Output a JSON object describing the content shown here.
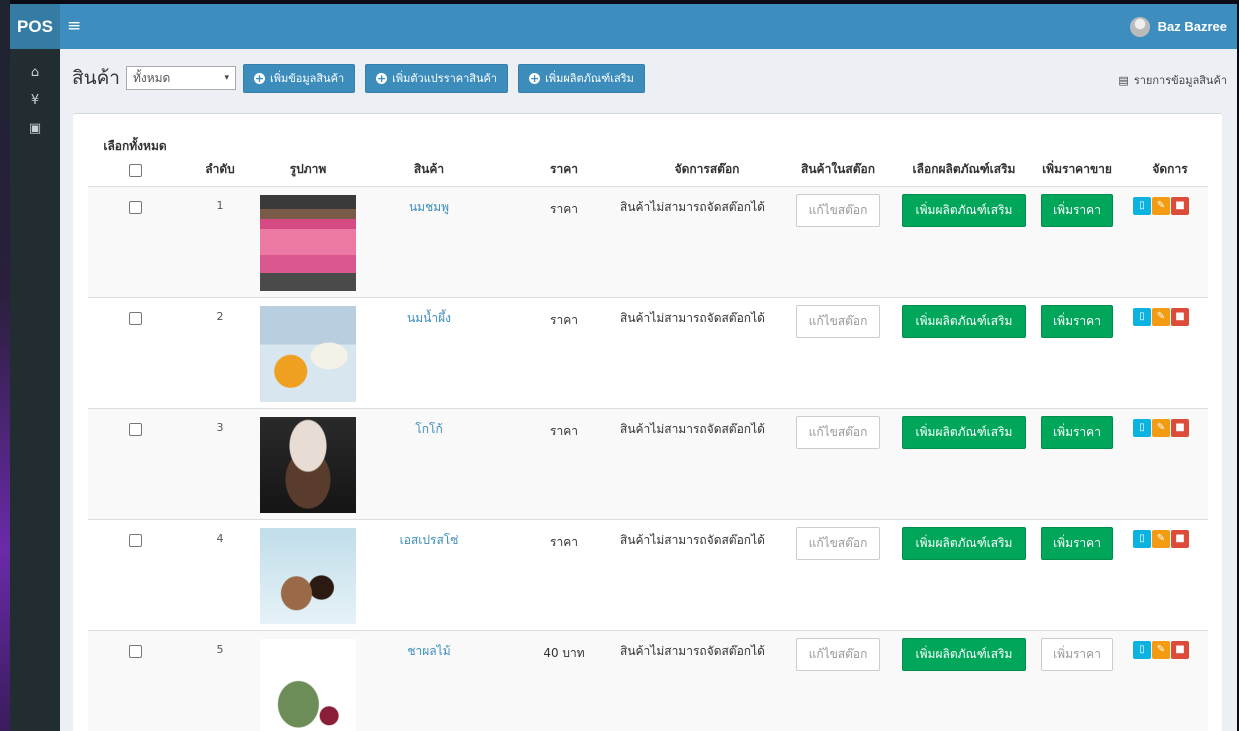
{
  "app": {
    "brand": "POS",
    "menu_icon": "≡",
    "user_name": "Baz Bazree"
  },
  "sidebar": {
    "items": [
      {
        "icon": "home-icon",
        "glyph": "⌂"
      },
      {
        "icon": "restaurant-icon",
        "glyph": "¥"
      },
      {
        "icon": "money-icon",
        "glyph": "▣"
      }
    ]
  },
  "page": {
    "title": "สินค้า",
    "category_filter": "ทั้งหมด",
    "buttons": {
      "add_product": "เพิ่มข้อมูลสินค้า",
      "add_price_variant": "เพิ่มตัวแปรราคาสินค้า",
      "add_addon": "เพิ่มผลิตภัณฑ์เสริม"
    },
    "list_link": "รายการข้อมูลสินค้า"
  },
  "table": {
    "headers": {
      "select_all": "เลือกทั้งหมด",
      "index": "ลำดับ",
      "image": "รูปภาพ",
      "product": "สินค้า",
      "price": "ราคา",
      "stock_manage": "จัดการสต๊อก",
      "in_stock": "สินค้าในสต๊อก",
      "select_addon": "เลือกผลิตภัณฑ์เสริม",
      "add_price": "เพิ่มราคาขาย",
      "manage": "จัดการ"
    },
    "rows": [
      {
        "index": "1",
        "name": "นมชมพู",
        "price": "ราคา",
        "stock_status": "สินค้าไม่สามารถจัดสต๊อกได้",
        "stock_placeholder": "แก้ไขสต๊อก",
        "addon_label": "เพิ่มผลิตภัณฑ์เสริม",
        "add_price_label": "เพิ่มราคา"
      },
      {
        "index": "2",
        "name": "นมน้ำผึ้ง",
        "price": "ราคา",
        "stock_status": "สินค้าไม่สามารถจัดสต๊อกได้",
        "stock_placeholder": "แก้ไขสต๊อก",
        "addon_label": "เพิ่มผลิตภัณฑ์เสริม",
        "add_price_label": "เพิ่มราคา"
      },
      {
        "index": "3",
        "name": "โกโก้",
        "price": "ราคา",
        "stock_status": "สินค้าไม่สามารถจัดสต๊อกได้",
        "stock_placeholder": "แก้ไขสต๊อก",
        "addon_label": "เพิ่มผลิตภัณฑ์เสริม",
        "add_price_label": "เพิ่มราคา"
      },
      {
        "index": "4",
        "name": "เอสเปรสโซ่",
        "price": "ราคา",
        "stock_status": "สินค้าไม่สามารถจัดสต๊อกได้",
        "stock_placeholder": "แก้ไขสต๊อก",
        "addon_label": "เพิ่มผลิตภัณฑ์เสริม",
        "add_price_label": "เพิ่มราคา"
      },
      {
        "index": "5",
        "name": "ชาผลไม้",
        "price": "40 บาท",
        "stock_status": "สินค้าไม่สามารถจัดสต๊อกได้",
        "stock_placeholder": "แก้ไขสต๊อก",
        "addon_label": "เพิ่มผลิตภัณฑ์เสริม",
        "add_price_placeholder": "เพิ่มราคา"
      }
    ]
  },
  "colors": {
    "topbar": "#3d8dbf",
    "brand_bg": "#357ca5",
    "sidebar": "#222d32",
    "primary": "#3c8dbc",
    "success": "#00a65a",
    "info": "#0cb2e0",
    "warning": "#f39c12",
    "danger": "#dd4b39"
  }
}
